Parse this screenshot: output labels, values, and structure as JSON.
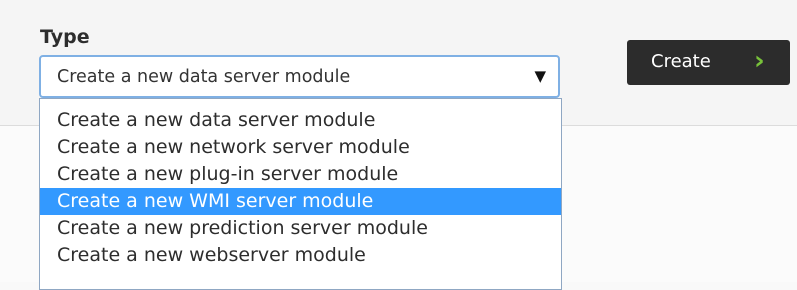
{
  "type_field": {
    "label": "Type",
    "selected_value": "Create a new  data server module"
  },
  "dropdown_options": [
    {
      "label": "Create a new data server module",
      "highlighted": false
    },
    {
      "label": "Create a new network server module",
      "highlighted": false
    },
    {
      "label": "Create a new plug-in server module",
      "highlighted": false
    },
    {
      "label": "Create a new WMI server module",
      "highlighted": true
    },
    {
      "label": "Create a new prediction server module",
      "highlighted": false
    },
    {
      "label": "Create a new webserver module",
      "highlighted": false
    }
  ],
  "create_button": {
    "label": "Create",
    "chevron": "›"
  },
  "icons": {
    "select_arrow": "▼",
    "create_chevron": "chevron-right-icon"
  },
  "colors": {
    "highlight": "#3399ff",
    "button_bg": "#2c2c2c",
    "chevron": "#78c23a",
    "select_border": "#7fb0e4"
  }
}
